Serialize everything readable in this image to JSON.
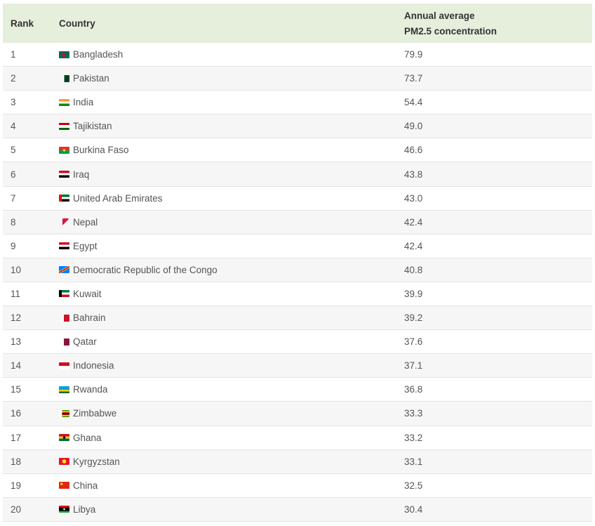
{
  "table": {
    "headers": {
      "rank": "Rank",
      "country": "Country",
      "value_line1": "Annual average",
      "value_line2": "PM2.5 concentration"
    },
    "rows": [
      {
        "rank": "1",
        "country": "Bangladesh",
        "value": "79.9",
        "flag": "bangladesh-flag-icon"
      },
      {
        "rank": "2",
        "country": "Pakistan",
        "value": "73.7",
        "flag": "pakistan-flag-icon"
      },
      {
        "rank": "3",
        "country": "India",
        "value": "54.4",
        "flag": "india-flag-icon"
      },
      {
        "rank": "4",
        "country": "Tajikistan",
        "value": "49.0",
        "flag": "tajikistan-flag-icon"
      },
      {
        "rank": "5",
        "country": "Burkina Faso",
        "value": "46.6",
        "flag": "burkina-faso-flag-icon"
      },
      {
        "rank": "6",
        "country": "Iraq",
        "value": "43.8",
        "flag": "iraq-flag-icon"
      },
      {
        "rank": "7",
        "country": "United Arab Emirates",
        "value": "43.0",
        "flag": "uae-flag-icon"
      },
      {
        "rank": "8",
        "country": "Nepal",
        "value": "42.4",
        "flag": "nepal-flag-icon"
      },
      {
        "rank": "9",
        "country": "Egypt",
        "value": "42.4",
        "flag": "egypt-flag-icon"
      },
      {
        "rank": "10",
        "country": "Democratic Republic of the Congo",
        "value": "40.8",
        "flag": "drc-flag-icon"
      },
      {
        "rank": "11",
        "country": "Kuwait",
        "value": "39.9",
        "flag": "kuwait-flag-icon"
      },
      {
        "rank": "12",
        "country": "Bahrain",
        "value": "39.2",
        "flag": "bahrain-flag-icon"
      },
      {
        "rank": "13",
        "country": "Qatar",
        "value": "37.6",
        "flag": "qatar-flag-icon"
      },
      {
        "rank": "14",
        "country": "Indonesia",
        "value": "37.1",
        "flag": "indonesia-flag-icon"
      },
      {
        "rank": "15",
        "country": "Rwanda",
        "value": "36.8",
        "flag": "rwanda-flag-icon"
      },
      {
        "rank": "16",
        "country": "Zimbabwe",
        "value": "33.3",
        "flag": "zimbabwe-flag-icon"
      },
      {
        "rank": "17",
        "country": "Ghana",
        "value": "33.2",
        "flag": "ghana-flag-icon"
      },
      {
        "rank": "18",
        "country": "Kyrgyzstan",
        "value": "33.1",
        "flag": "kyrgyzstan-flag-icon"
      },
      {
        "rank": "19",
        "country": "China",
        "value": "32.5",
        "flag": "china-flag-icon"
      },
      {
        "rank": "20",
        "country": "Libya",
        "value": "30.4",
        "flag": "libya-flag-icon"
      }
    ]
  },
  "colors": {
    "header_bg": "#e6eedc",
    "row_alt_bg": "#f6f6f6",
    "text": "#555555",
    "header_text": "#333333"
  }
}
